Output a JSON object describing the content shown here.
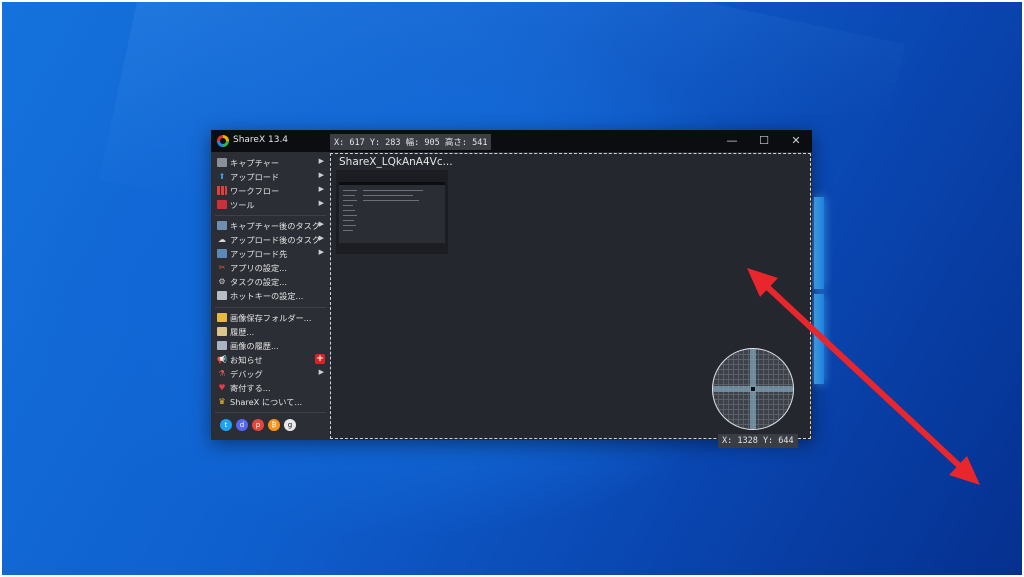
{
  "app": {
    "title": "ShareX 13.4",
    "window_controls": {
      "minimize": "—",
      "maximize": "☐",
      "close": "✕"
    }
  },
  "overlay": {
    "region_info": "X: 617 Y: 283 幅: 905 高さ: 541",
    "cursor_info": "X: 1328 Y: 644"
  },
  "menu": {
    "items": [
      {
        "label": "キャプチャー",
        "icon": "monitor-icon",
        "submenu": true
      },
      {
        "label": "アップロード",
        "icon": "upload-arrow-icon",
        "submenu": true
      },
      {
        "label": "ワークフロー",
        "icon": "grid-icon",
        "submenu": true
      },
      {
        "label": "ツール",
        "icon": "toolbox-icon",
        "submenu": true
      },
      {
        "label": "キャプチャー後のタスク",
        "icon": "image-task-icon",
        "submenu": true
      },
      {
        "label": "アップロード後のタスク",
        "icon": "cloud-icon",
        "submenu": true
      },
      {
        "label": "アップロード先",
        "icon": "server-icon",
        "submenu": true
      },
      {
        "label": "アプリの設定...",
        "icon": "tools-icon",
        "submenu": false
      },
      {
        "label": "タスクの設定...",
        "icon": "gear-icon",
        "submenu": false
      },
      {
        "label": "ホットキーの設定...",
        "icon": "keyboard-icon",
        "submenu": false
      },
      {
        "label": "画像保存フォルダー...",
        "icon": "folder-icon",
        "submenu": false
      },
      {
        "label": "履歴...",
        "icon": "history-icon",
        "submenu": false
      },
      {
        "label": "画像の履歴...",
        "icon": "image-history-icon",
        "submenu": false
      },
      {
        "label": "お知らせ",
        "icon": "megaphone-icon",
        "submenu": false,
        "badge": "+"
      },
      {
        "label": "デバッグ",
        "icon": "flask-icon",
        "submenu": true
      },
      {
        "label": "寄付する...",
        "icon": "heart-icon",
        "submenu": false
      },
      {
        "label": "ShareX について...",
        "icon": "crown-icon",
        "submenu": false
      }
    ],
    "social": [
      "twitter-icon",
      "discord-icon",
      "patreon-icon",
      "bitcoin-icon",
      "github-icon"
    ]
  },
  "content": {
    "thumbnail_title": "ShareX_LQkAnA4Vc..."
  },
  "colors": {
    "annotation_arrow": "#e8262b",
    "app_background": "#24272e",
    "menu_background": "#2b2e35",
    "titlebar": "#0c0d10"
  }
}
